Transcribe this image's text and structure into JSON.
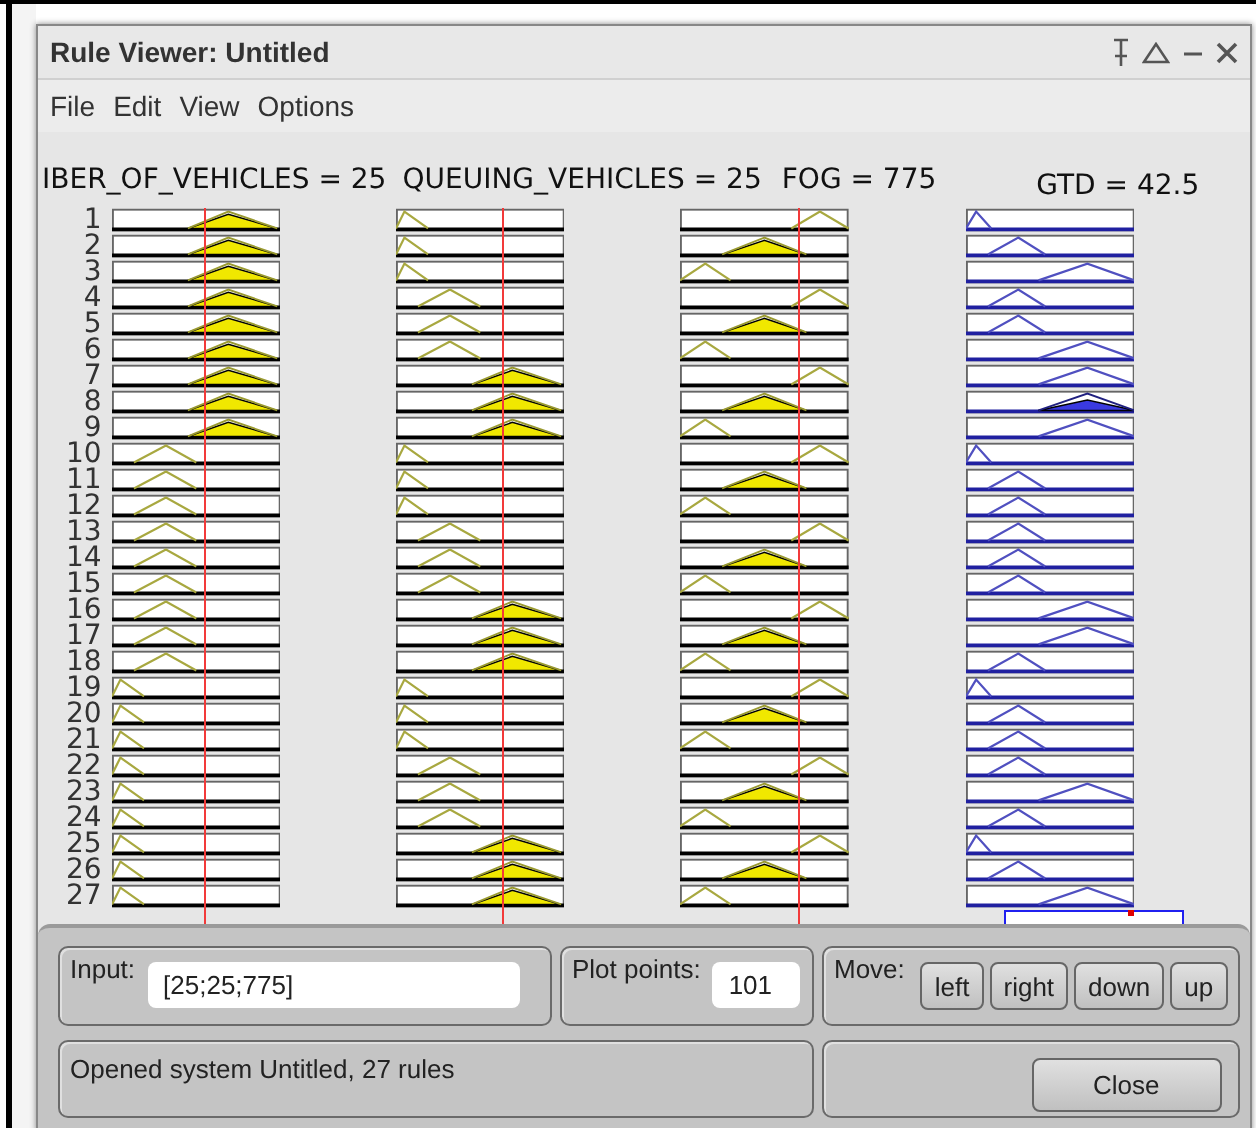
{
  "window": {
    "title": "Rule Viewer: Untitled"
  },
  "menu": [
    "File",
    "Edit",
    "View",
    "Options"
  ],
  "variables": [
    {
      "label": "IBER_OF_VEHICLES = 25"
    },
    {
      "label": "QUEUING_VEHICLES = 25"
    },
    {
      "label": "FOG = 775"
    },
    {
      "label": "GTD = 42.5"
    }
  ],
  "rules": [
    {
      "number": "1",
      "cells": [
        {
          "kind": "high",
          "active": true
        },
        {
          "kind": "low",
          "active": false
        },
        {
          "kind": "high",
          "active": false
        },
        {
          "kind": "low",
          "active": false
        }
      ]
    },
    {
      "number": "2",
      "cells": [
        {
          "kind": "high",
          "active": true
        },
        {
          "kind": "low",
          "active": false
        },
        {
          "kind": "mid",
          "active": true
        },
        {
          "kind": "mid",
          "active": false
        }
      ]
    },
    {
      "number": "3",
      "cells": [
        {
          "kind": "high",
          "active": true
        },
        {
          "kind": "low",
          "active": false
        },
        {
          "kind": "low",
          "active": false
        },
        {
          "kind": "high",
          "active": false
        }
      ]
    },
    {
      "number": "4",
      "cells": [
        {
          "kind": "high",
          "active": true
        },
        {
          "kind": "mid",
          "active": false
        },
        {
          "kind": "high",
          "active": false
        },
        {
          "kind": "mid",
          "active": false
        }
      ]
    },
    {
      "number": "5",
      "cells": [
        {
          "kind": "high",
          "active": true
        },
        {
          "kind": "mid",
          "active": false
        },
        {
          "kind": "mid",
          "active": true
        },
        {
          "kind": "mid",
          "active": false
        }
      ]
    },
    {
      "number": "6",
      "cells": [
        {
          "kind": "high",
          "active": true
        },
        {
          "kind": "mid",
          "active": false
        },
        {
          "kind": "low",
          "active": false
        },
        {
          "kind": "high",
          "active": false
        }
      ]
    },
    {
      "number": "7",
      "cells": [
        {
          "kind": "high",
          "active": true
        },
        {
          "kind": "high",
          "active": true
        },
        {
          "kind": "high",
          "active": false
        },
        {
          "kind": "high",
          "active": false
        }
      ]
    },
    {
      "number": "8",
      "cells": [
        {
          "kind": "high",
          "active": true
        },
        {
          "kind": "high",
          "active": true
        },
        {
          "kind": "mid",
          "active": true
        },
        {
          "kind": "high",
          "active": true
        }
      ]
    },
    {
      "number": "9",
      "cells": [
        {
          "kind": "high",
          "active": true
        },
        {
          "kind": "high",
          "active": true
        },
        {
          "kind": "low",
          "active": false
        },
        {
          "kind": "high",
          "active": false
        }
      ]
    },
    {
      "number": "10",
      "cells": [
        {
          "kind": "mid",
          "active": false
        },
        {
          "kind": "low",
          "active": false
        },
        {
          "kind": "high",
          "active": false
        },
        {
          "kind": "low",
          "active": false
        }
      ]
    },
    {
      "number": "11",
      "cells": [
        {
          "kind": "mid",
          "active": false
        },
        {
          "kind": "low",
          "active": false
        },
        {
          "kind": "mid",
          "active": true
        },
        {
          "kind": "mid",
          "active": false
        }
      ]
    },
    {
      "number": "12",
      "cells": [
        {
          "kind": "mid",
          "active": false
        },
        {
          "kind": "low",
          "active": false
        },
        {
          "kind": "low",
          "active": false
        },
        {
          "kind": "mid",
          "active": false
        }
      ]
    },
    {
      "number": "13",
      "cells": [
        {
          "kind": "mid",
          "active": false
        },
        {
          "kind": "mid",
          "active": false
        },
        {
          "kind": "high",
          "active": false
        },
        {
          "kind": "mid",
          "active": false
        }
      ]
    },
    {
      "number": "14",
      "cells": [
        {
          "kind": "mid",
          "active": false
        },
        {
          "kind": "mid",
          "active": false
        },
        {
          "kind": "mid",
          "active": true
        },
        {
          "kind": "mid",
          "active": false
        }
      ]
    },
    {
      "number": "15",
      "cells": [
        {
          "kind": "mid",
          "active": false
        },
        {
          "kind": "mid",
          "active": false
        },
        {
          "kind": "low",
          "active": false
        },
        {
          "kind": "mid",
          "active": false
        }
      ]
    },
    {
      "number": "16",
      "cells": [
        {
          "kind": "mid",
          "active": false
        },
        {
          "kind": "high",
          "active": true
        },
        {
          "kind": "high",
          "active": false
        },
        {
          "kind": "high",
          "active": false
        }
      ]
    },
    {
      "number": "17",
      "cells": [
        {
          "kind": "mid",
          "active": false
        },
        {
          "kind": "high",
          "active": true
        },
        {
          "kind": "mid",
          "active": true
        },
        {
          "kind": "high",
          "active": false
        }
      ]
    },
    {
      "number": "18",
      "cells": [
        {
          "kind": "mid",
          "active": false
        },
        {
          "kind": "high",
          "active": true
        },
        {
          "kind": "low",
          "active": false
        },
        {
          "kind": "mid",
          "active": false
        }
      ]
    },
    {
      "number": "19",
      "cells": [
        {
          "kind": "low",
          "active": false
        },
        {
          "kind": "low",
          "active": false
        },
        {
          "kind": "high",
          "active": false
        },
        {
          "kind": "low",
          "active": false
        }
      ]
    },
    {
      "number": "20",
      "cells": [
        {
          "kind": "low",
          "active": false
        },
        {
          "kind": "low",
          "active": false
        },
        {
          "kind": "mid",
          "active": true
        },
        {
          "kind": "mid",
          "active": false
        }
      ]
    },
    {
      "number": "21",
      "cells": [
        {
          "kind": "low",
          "active": false
        },
        {
          "kind": "low",
          "active": false
        },
        {
          "kind": "low",
          "active": false
        },
        {
          "kind": "mid",
          "active": false
        }
      ]
    },
    {
      "number": "22",
      "cells": [
        {
          "kind": "low",
          "active": false
        },
        {
          "kind": "mid",
          "active": false
        },
        {
          "kind": "high",
          "active": false
        },
        {
          "kind": "mid",
          "active": false
        }
      ]
    },
    {
      "number": "23",
      "cells": [
        {
          "kind": "low",
          "active": false
        },
        {
          "kind": "mid",
          "active": false
        },
        {
          "kind": "mid",
          "active": true
        },
        {
          "kind": "high",
          "active": false
        }
      ]
    },
    {
      "number": "24",
      "cells": [
        {
          "kind": "low",
          "active": false
        },
        {
          "kind": "mid",
          "active": false
        },
        {
          "kind": "low",
          "active": false
        },
        {
          "kind": "mid",
          "active": false
        }
      ]
    },
    {
      "number": "25",
      "cells": [
        {
          "kind": "low",
          "active": false
        },
        {
          "kind": "high",
          "active": true
        },
        {
          "kind": "high",
          "active": false
        },
        {
          "kind": "low",
          "active": false
        }
      ]
    },
    {
      "number": "26",
      "cells": [
        {
          "kind": "low",
          "active": false
        },
        {
          "kind": "high",
          "active": true
        },
        {
          "kind": "mid",
          "active": true
        },
        {
          "kind": "mid",
          "active": false
        }
      ]
    },
    {
      "number": "27",
      "cells": [
        {
          "kind": "low",
          "active": false
        },
        {
          "kind": "high",
          "active": true
        },
        {
          "kind": "low",
          "active": false
        },
        {
          "kind": "high",
          "active": false
        }
      ]
    }
  ],
  "input": {
    "label": "Input:",
    "value": "[25;25;775]"
  },
  "plot_points": {
    "label": "Plot points:",
    "value": "101"
  },
  "move": {
    "label": "Move:",
    "buttons": [
      "left",
      "right",
      "down",
      "up"
    ]
  },
  "status": "Opened system Untitled, 27 rules",
  "close_button": "Close"
}
